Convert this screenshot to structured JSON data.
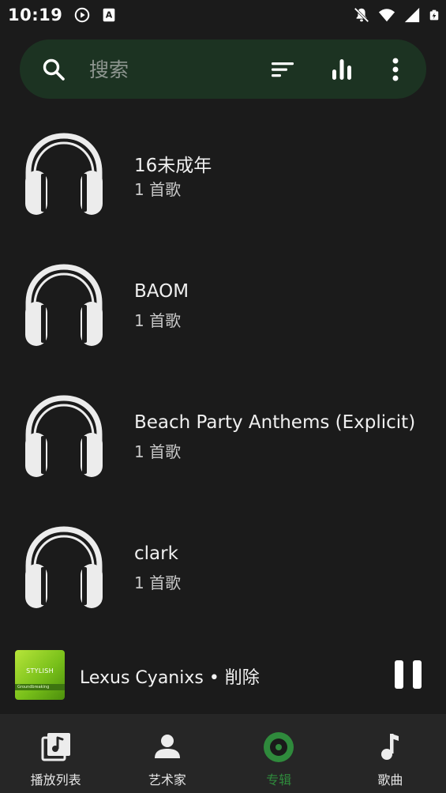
{
  "status_bar": {
    "time": "10:19",
    "left_icons": [
      "play-circle-icon",
      "font-a-icon"
    ],
    "right_icons": [
      "notifications-off-icon",
      "wifi-icon",
      "cell-signal-icon",
      "battery-charging-icon"
    ]
  },
  "search": {
    "placeholder": "搜索",
    "icons": [
      "search-icon",
      "sort-icon",
      "equalizer-icon",
      "more-vert-icon"
    ]
  },
  "albums": [
    {
      "title": "16未成年",
      "count": "1 首歌"
    },
    {
      "title": "BAOM",
      "count": "1 首歌"
    },
    {
      "title": "Beach Party Anthems (Explicit)",
      "count": "1 首歌"
    },
    {
      "title": "clark",
      "count": "1 首歌"
    }
  ],
  "album_art_icon": "headphones-icon",
  "player": {
    "title": "Lexus Cyanixs • 削除",
    "cover_text": "STYLISH",
    "cover_subtext": "Groundbreaking",
    "state_icon": "pause-icon"
  },
  "nav": {
    "items": [
      {
        "label": "播放列表",
        "icon": "playlist-icon"
      },
      {
        "label": "艺术家",
        "icon": "artist-icon"
      },
      {
        "label": "专辑",
        "icon": "album-icon",
        "active": true
      },
      {
        "label": "歌曲",
        "icon": "music-note-icon"
      }
    ]
  },
  "colors": {
    "background": "#1b1b1b",
    "search_bar": "#1c3322",
    "accent": "#2f8a3c",
    "nav_bar": "#262626"
  }
}
